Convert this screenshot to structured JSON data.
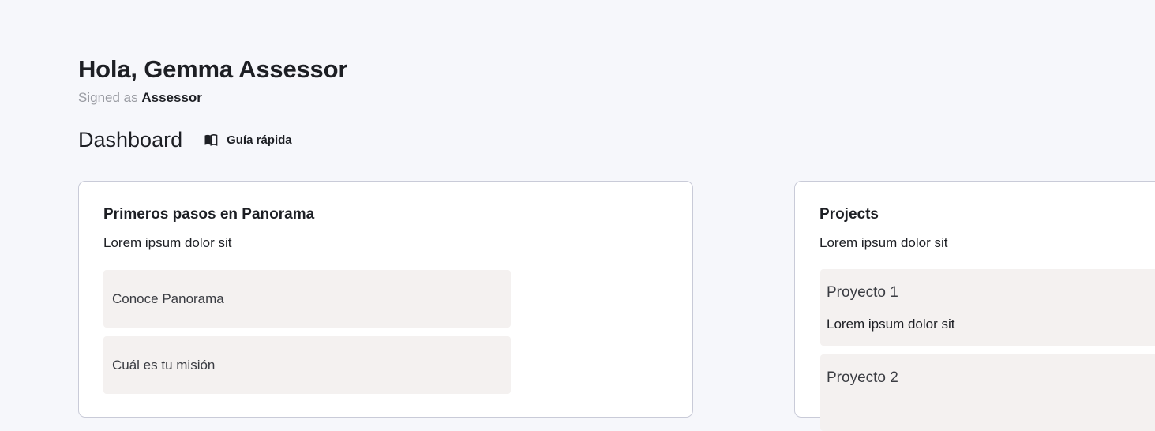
{
  "header": {
    "greeting": "Hola, Gemma Assessor",
    "signed_as_prefix": "Signed as",
    "signed_as_role": "Assessor"
  },
  "dashboard": {
    "title": "Dashboard",
    "guide_label": "Guía rápida",
    "guide_icon": "book-icon"
  },
  "getting_started": {
    "title": "Primeros pasos en Panorama",
    "subtitle": "Lorem ipsum dolor sit",
    "items": [
      {
        "label": "Conoce Panorama"
      },
      {
        "label": "Cuál es tu misión"
      }
    ]
  },
  "projects": {
    "title": "Projects",
    "subtitle": "Lorem ipsum dolor sit",
    "items": [
      {
        "name": "Proyecto 1",
        "description": "Lorem ipsum dolor sit"
      },
      {
        "name": "Proyecto 2",
        "description": ""
      }
    ]
  }
}
